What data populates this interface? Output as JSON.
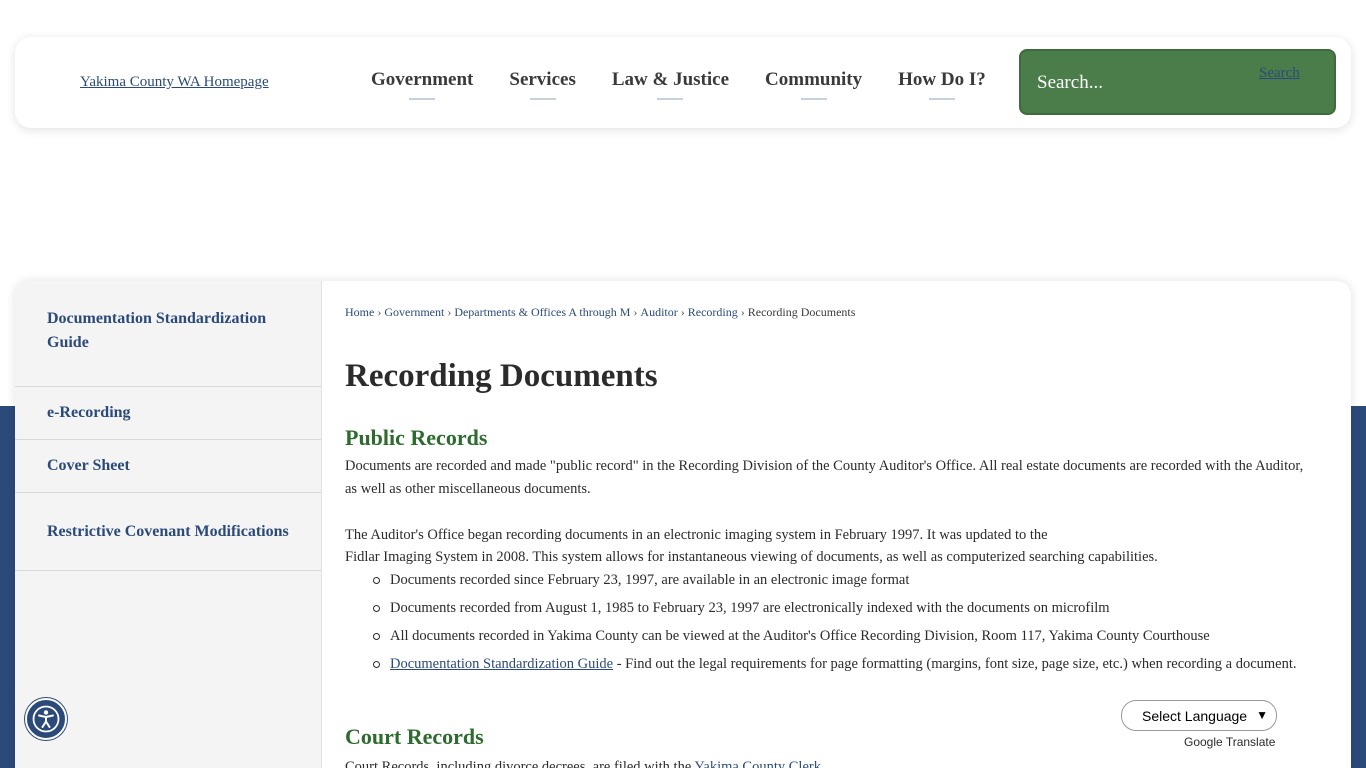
{
  "header": {
    "logo_alt": "Yakima County WA Homepage",
    "nav": [
      {
        "label": "Government"
      },
      {
        "label": "Services"
      },
      {
        "label": "Law & Justice"
      },
      {
        "label": "Community"
      },
      {
        "label": "How Do I?"
      }
    ],
    "search": {
      "placeholder": "Search...",
      "button_alt": "Search"
    }
  },
  "sidebar": {
    "items": [
      {
        "label": "Documentation Standardization Guide"
      },
      {
        "label": "e-Recording"
      },
      {
        "label": "Cover Sheet"
      },
      {
        "label": "Restrictive Covenant Modifications"
      }
    ]
  },
  "breadcrumb": {
    "items": [
      "Home",
      "Government",
      "Departments & Offices A through M",
      "Auditor",
      "Recording"
    ],
    "current": "Recording Documents",
    "separator": "›"
  },
  "main": {
    "title": "Recording Documents",
    "public_records": {
      "heading": "Public Records",
      "para1": "Documents are recorded and made \"public record\" in the Recording Division of the County Auditor's Office.  All real estate documents are recorded with the Auditor, as well as other miscellaneous documents.",
      "para2_line1": "The Auditor's Office began recording documents in an electronic imaging system in February 1997.  It was updated to the",
      "para2_line2": "Fidlar Imaging System in 2008.  This system allows for instantaneous viewing of documents, as well as computerized searching capabilities.",
      "bullets": [
        "Documents recorded since February 23, 1997, are available in an electronic image format",
        "Documents recorded from August 1, 1985 to February 23, 1997 are electronically indexed with the documents on microfilm",
        "All documents recorded in Yakima County can be viewed at the Auditor's Office Recording Division, Room 117, Yakima County Courthouse"
      ],
      "bullet_link": "Documentation Standardization Guide",
      "bullet_link_text": " - Find out the legal requirements for page formatting (margins, font size, page size, etc.) when recording a document."
    },
    "court_records": {
      "heading": "Court Records",
      "text": "Court Records, including divorce decrees, are filed with the ",
      "link": "Yakima County Clerk"
    }
  },
  "footer_widgets": {
    "language_select": "Select Language",
    "google_translate_alt": "Google Translate",
    "translate_label": "Translate"
  },
  "colors": {
    "brand_blue": "#2b4a7a",
    "heading_green": "#2e6b2e",
    "search_green": "#4b7d4a"
  }
}
